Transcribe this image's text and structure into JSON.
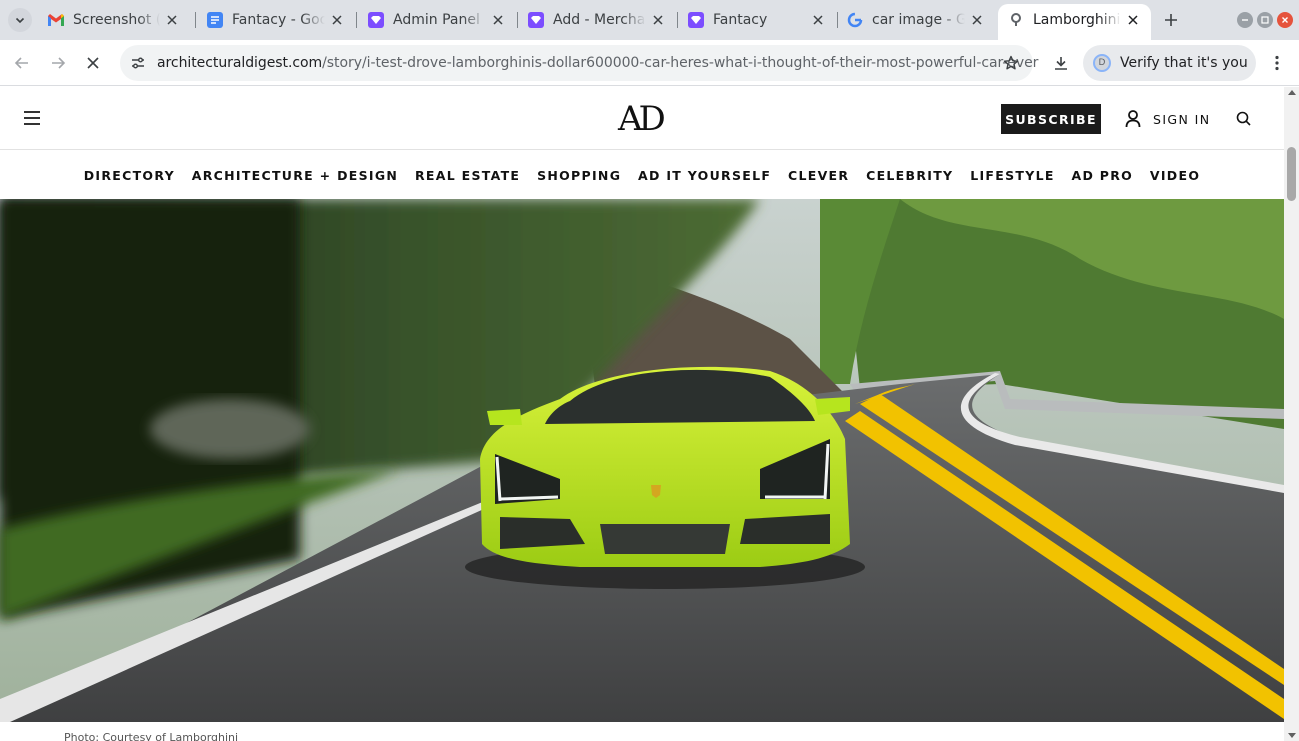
{
  "browser": {
    "tabs": [
      {
        "title": "Screenshot (",
        "icon": "gmail-icon",
        "active": false
      },
      {
        "title": "Fantacy - Goo",
        "icon": "google-docs-icon",
        "active": false
      },
      {
        "title": "Admin Panel",
        "icon": "app-icon",
        "active": false
      },
      {
        "title": "Add - Mercha",
        "icon": "app-icon",
        "active": false
      },
      {
        "title": "Fantacy",
        "icon": "app-icon",
        "active": false
      },
      {
        "title": "car image - G",
        "icon": "google-icon",
        "active": false
      },
      {
        "title": "Lamborghini",
        "icon": "site-icon",
        "active": true
      }
    ],
    "url_host": "architecturaldigest.com",
    "url_path": "/story/i-test-drove-lamborghinis-dollar600000-car-heres-what-i-thought-of-their-most-powerful-car-ever",
    "verify_label": "Verify that it's you",
    "verify_avatar": "D"
  },
  "site": {
    "logo": "AD",
    "subscribe_label": "SUBSCRIBE",
    "signin_label": "SIGN IN",
    "nav": [
      "DIRECTORY",
      "ARCHITECTURE + DESIGN",
      "REAL ESTATE",
      "SHOPPING",
      "AD IT YOURSELF",
      "CLEVER",
      "CELEBRITY",
      "LIFESTYLE",
      "AD PRO",
      "VIDEO"
    ],
    "hero_caption": "Photo: Courtesy of Lamborghini"
  },
  "colors": {
    "car": "#b6e51e",
    "road": "#4a4b4c",
    "road_line": "#f2c200",
    "accent_tab_icon": "#7c4dff"
  }
}
